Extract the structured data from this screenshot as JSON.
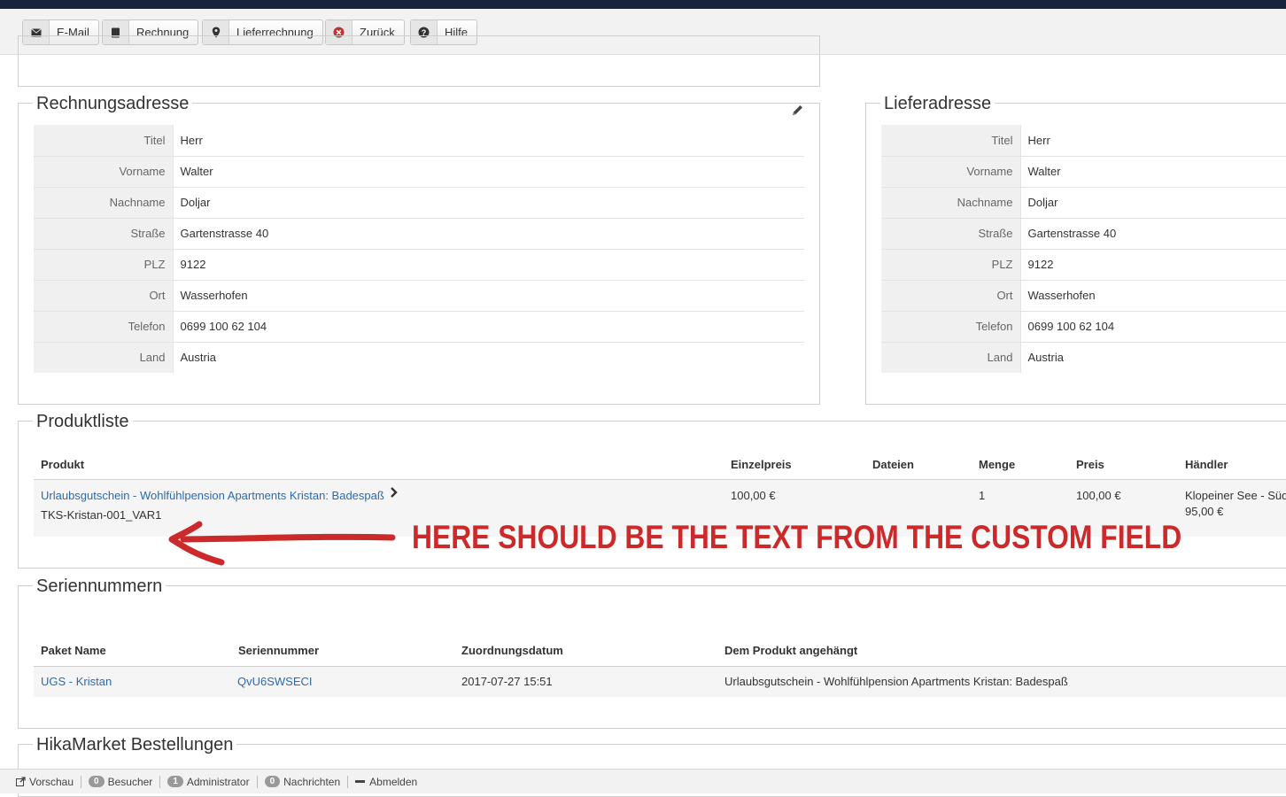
{
  "toolbar": {
    "buttons": [
      {
        "label": "E-Mail",
        "icon": "envelope-icon"
      },
      {
        "label": "Rechnung",
        "icon": "book-icon"
      },
      {
        "label": "Lieferrechnung",
        "icon": "map-pin-icon"
      },
      {
        "label": "Zurück",
        "icon": "cancel-circle-icon"
      },
      {
        "label": "Hilfe",
        "icon": "question-circle-icon"
      }
    ]
  },
  "billing": {
    "title": "Rechnungsadresse",
    "rows": [
      {
        "k": "Titel",
        "v": "Herr"
      },
      {
        "k": "Vorname",
        "v": "Walter"
      },
      {
        "k": "Nachname",
        "v": "Doljar"
      },
      {
        "k": "Straße",
        "v": "Gartenstrasse 40"
      },
      {
        "k": "PLZ",
        "v": "9122"
      },
      {
        "k": "Ort",
        "v": "Wasserhofen"
      },
      {
        "k": "Telefon",
        "v": "0699 100 62 104"
      },
      {
        "k": "Land",
        "v": "Austria"
      }
    ]
  },
  "shipping": {
    "title": "Lieferadresse",
    "rows": [
      {
        "k": "Titel",
        "v": "Herr"
      },
      {
        "k": "Vorname",
        "v": "Walter"
      },
      {
        "k": "Nachname",
        "v": "Doljar"
      },
      {
        "k": "Straße",
        "v": "Gartenstrasse 40"
      },
      {
        "k": "PLZ",
        "v": "9122"
      },
      {
        "k": "Ort",
        "v": "Wasserhofen"
      },
      {
        "k": "Telefon",
        "v": "0699 100 62 104"
      },
      {
        "k": "Land",
        "v": "Austria"
      }
    ]
  },
  "products": {
    "title": "Produktliste",
    "headers": {
      "produkt": "Produkt",
      "einzelpreis": "Einzelpreis",
      "dateien": "Dateien",
      "menge": "Menge",
      "preis": "Preis",
      "haendler": "Händler"
    },
    "row": {
      "name": "Urlaubsgutschein - Wohlfühlpension Apartments Kristan: Badespaß",
      "sku": "TKS-Kristan-001_VAR1",
      "einzelpreis": "100,00 €",
      "menge": "1",
      "preis": "100,00 €",
      "haendler": "Klopeiner See - Süd",
      "haendler_price": "95,00 €"
    }
  },
  "annotation": "HERE SHOULD BE THE TEXT FROM THE CUSTOM FIELD",
  "serials": {
    "title": "Seriennummern",
    "headers": {
      "paket": "Paket Name",
      "serial": "Seriennummer",
      "datum": "Zuordnungsdatum",
      "produkt": "Dem Produkt angehängt"
    },
    "row": {
      "paket": "UGS - Kristan",
      "serial": "QvU6SWSECI",
      "datum": "2017-07-27 15:51",
      "produkt": "Urlaubsgutschein - Wohlfühlpension Apartments Kristan: Badespaß"
    }
  },
  "hikamarket": {
    "title": "HikaMarket Bestellungen"
  },
  "statusbar": {
    "vorschau": "Vorschau",
    "besucher_count": "0",
    "besucher": "Besucher",
    "admin_count": "1",
    "admin": "Administrator",
    "nachrichten_count": "0",
    "nachrichten": "Nachrichten",
    "abmelden": "Abmelden"
  },
  "colors": {
    "link": "#2a6ab3",
    "annotation": "#cc2a2a",
    "topbar": "#17233a"
  }
}
